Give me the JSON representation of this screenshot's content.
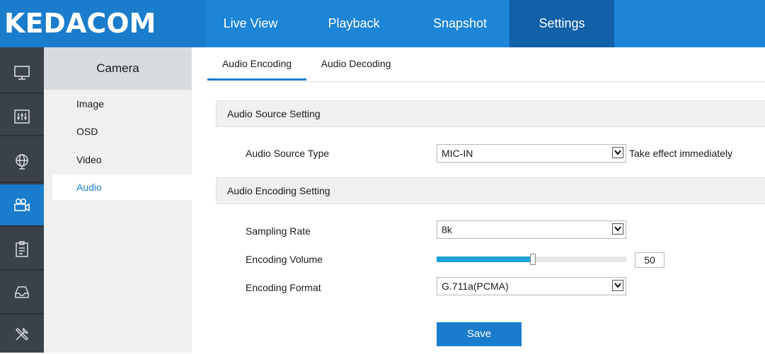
{
  "app": {
    "logo": "KEDACOM",
    "accent_color": "#1b7ccb",
    "nav": [
      {
        "label": "Live View",
        "active": false
      },
      {
        "label": "Playback",
        "active": false
      },
      {
        "label": "Snapshot",
        "active": false
      },
      {
        "label": "Settings",
        "active": true
      }
    ]
  },
  "icon_bar": [
    {
      "icon": "monitor-icon",
      "active": false
    },
    {
      "icon": "equalizer-icon",
      "active": false
    },
    {
      "icon": "globe-icon",
      "active": false
    },
    {
      "icon": "camera-icon",
      "active": true
    },
    {
      "icon": "clipboard-icon",
      "active": false
    },
    {
      "icon": "storage-icon",
      "active": false
    },
    {
      "icon": "tools-icon",
      "active": false
    }
  ],
  "sidebar": {
    "header": "Camera",
    "items": [
      {
        "label": "Image",
        "active": false
      },
      {
        "label": "OSD",
        "active": false
      },
      {
        "label": "Video",
        "active": false
      },
      {
        "label": "Audio",
        "active": true
      }
    ]
  },
  "tabs": [
    {
      "label": "Audio Encoding",
      "active": true
    },
    {
      "label": "Audio Decoding",
      "active": false
    }
  ],
  "audio_source": {
    "section_title": "Audio Source Setting",
    "type_label": "Audio Source Type",
    "type_value": "MIC-IN",
    "note": "Take effect immediately"
  },
  "audio_encoding": {
    "section_title": "Audio Encoding Setting",
    "sampling_label": "Sampling Rate",
    "sampling_value": "8k",
    "volume_label": "Encoding Volume",
    "volume_value": "50",
    "volume_fraction": 0.5,
    "format_label": "Encoding Format",
    "format_value": "G.711a(PCMA)"
  },
  "save_label": "Save"
}
